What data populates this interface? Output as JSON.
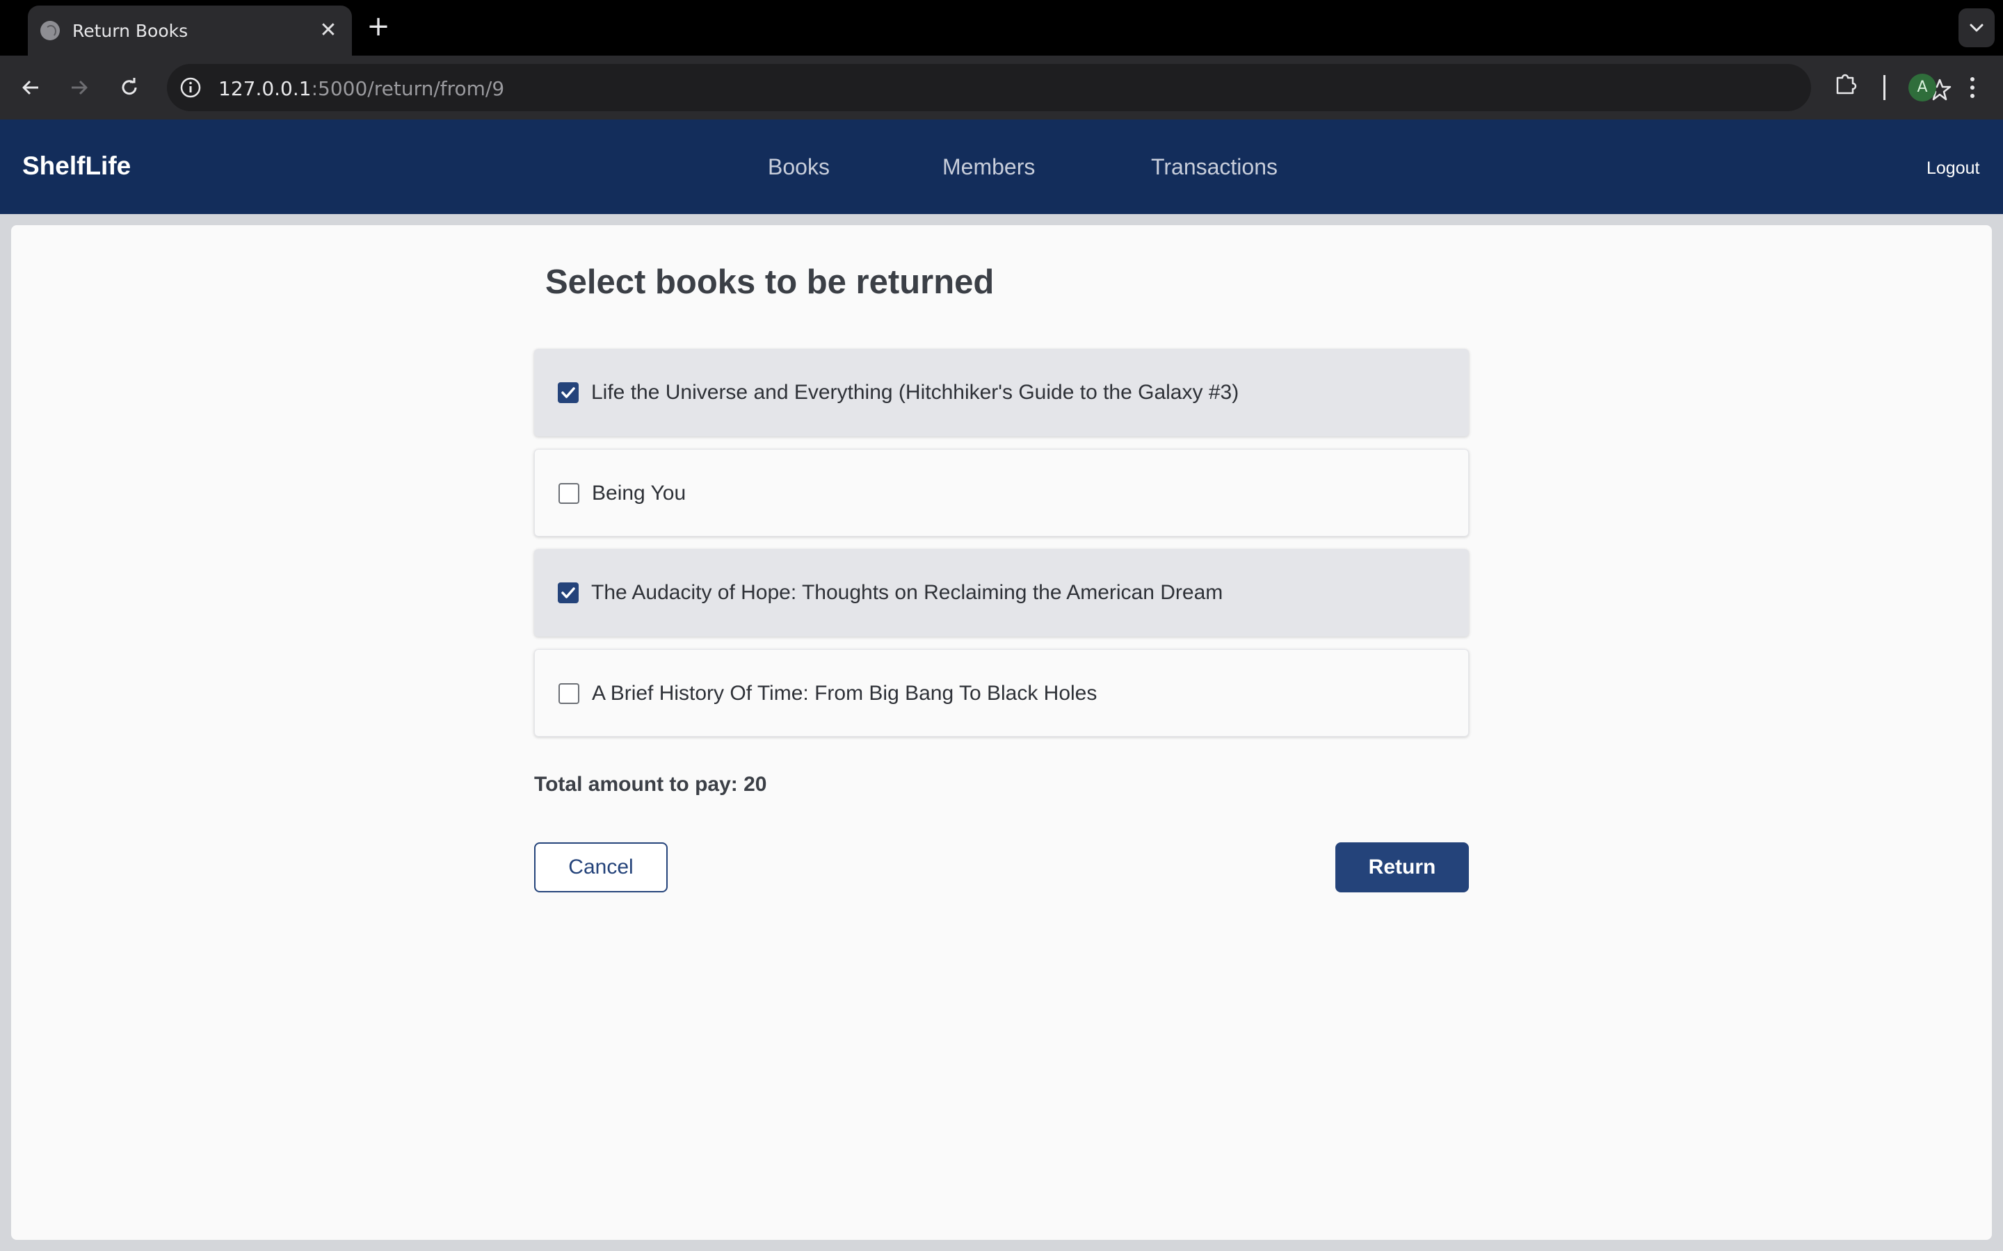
{
  "browser": {
    "tab_title": "Return Books",
    "url_host": "127.0.0.1",
    "url_path": ":5000/return/from/9",
    "profile_initial": "A"
  },
  "app": {
    "brand": "ShelfLife",
    "nav": [
      "Books",
      "Members",
      "Transactions"
    ],
    "logout": "Logout",
    "accent_color": "#132d5b"
  },
  "page": {
    "title": "Select books to be returned",
    "books": [
      {
        "title": "Life the Universe and Everything (Hitchhiker's Guide to the Galaxy #3)",
        "checked": true
      },
      {
        "title": "Being You",
        "checked": false
      },
      {
        "title": "The Audacity of Hope: Thoughts on Reclaiming the American Dream",
        "checked": true
      },
      {
        "title": "A Brief History Of Time: From Big Bang To Black Holes",
        "checked": false
      }
    ],
    "total_text": "Total amount to pay: 20",
    "cancel_label": "Cancel",
    "return_label": "Return"
  }
}
